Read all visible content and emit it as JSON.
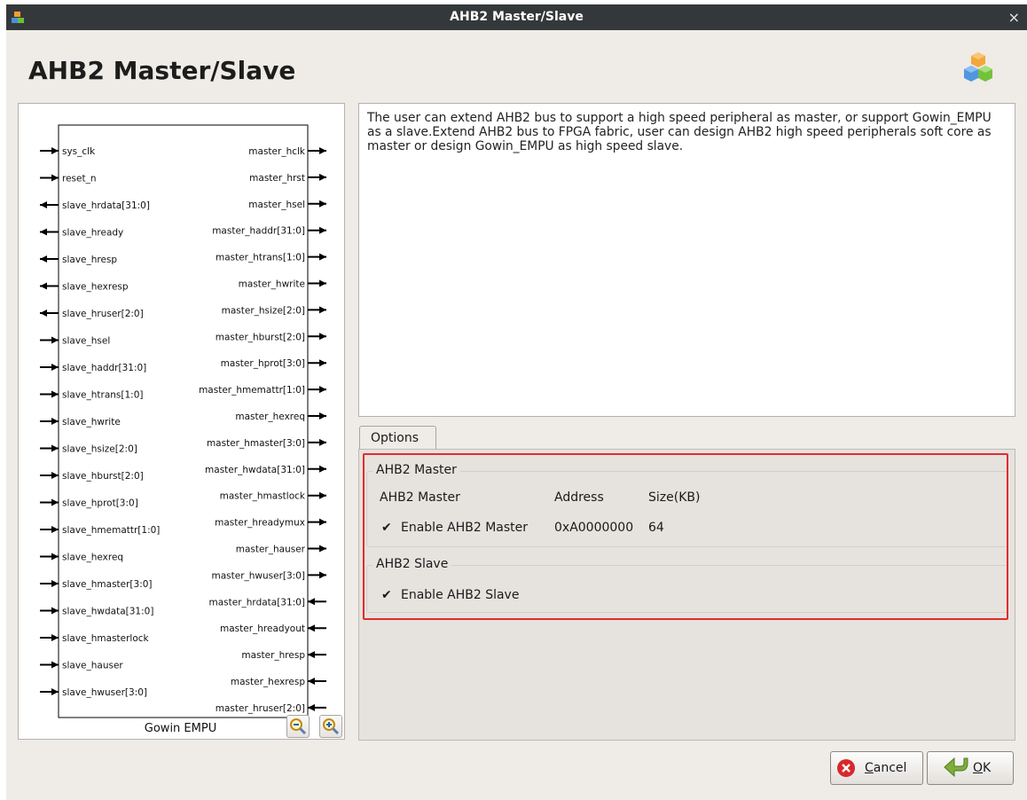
{
  "window": {
    "title": "AHB2 Master/Slave",
    "close_glyph": "×",
    "heading": "AHB2 Master/Slave",
    "app_icon": "cubes-icon",
    "logo_icon": "cubes-logo-icon"
  },
  "diagram": {
    "block_name": "Gowin EMPU",
    "left_ports": [
      {
        "name": "sys_clk",
        "dir": "in"
      },
      {
        "name": "reset_n",
        "dir": "in"
      },
      {
        "name": "slave_hrdata[31:0]",
        "dir": "out"
      },
      {
        "name": "slave_hready",
        "dir": "out"
      },
      {
        "name": "slave_hresp",
        "dir": "out"
      },
      {
        "name": "slave_hexresp",
        "dir": "out"
      },
      {
        "name": "slave_hruser[2:0]",
        "dir": "out"
      },
      {
        "name": "slave_hsel",
        "dir": "in"
      },
      {
        "name": "slave_haddr[31:0]",
        "dir": "in"
      },
      {
        "name": "slave_htrans[1:0]",
        "dir": "in"
      },
      {
        "name": "slave_hwrite",
        "dir": "in"
      },
      {
        "name": "slave_hsize[2:0]",
        "dir": "in"
      },
      {
        "name": "slave_hburst[2:0]",
        "dir": "in"
      },
      {
        "name": "slave_hprot[3:0]",
        "dir": "in"
      },
      {
        "name": "slave_hmemattr[1:0]",
        "dir": "in"
      },
      {
        "name": "slave_hexreq",
        "dir": "in"
      },
      {
        "name": "slave_hmaster[3:0]",
        "dir": "in"
      },
      {
        "name": "slave_hwdata[31:0]",
        "dir": "in"
      },
      {
        "name": "slave_hmasterlock",
        "dir": "in"
      },
      {
        "name": "slave_hauser",
        "dir": "in"
      },
      {
        "name": "slave_hwuser[3:0]",
        "dir": "in"
      }
    ],
    "right_ports": [
      {
        "name": "master_hclk",
        "dir": "out"
      },
      {
        "name": "master_hrst",
        "dir": "out"
      },
      {
        "name": "master_hsel",
        "dir": "out"
      },
      {
        "name": "master_haddr[31:0]",
        "dir": "out"
      },
      {
        "name": "master_htrans[1:0]",
        "dir": "out"
      },
      {
        "name": "master_hwrite",
        "dir": "out"
      },
      {
        "name": "master_hsize[2:0]",
        "dir": "out"
      },
      {
        "name": "master_hburst[2:0]",
        "dir": "out"
      },
      {
        "name": "master_hprot[3:0]",
        "dir": "out"
      },
      {
        "name": "master_hmemattr[1:0]",
        "dir": "out"
      },
      {
        "name": "master_hexreq",
        "dir": "out"
      },
      {
        "name": "master_hmaster[3:0]",
        "dir": "out"
      },
      {
        "name": "master_hwdata[31:0]",
        "dir": "out"
      },
      {
        "name": "master_hmastlock",
        "dir": "out"
      },
      {
        "name": "master_hreadymux",
        "dir": "out"
      },
      {
        "name": "master_hauser",
        "dir": "out"
      },
      {
        "name": "master_hwuser[3:0]",
        "dir": "out"
      },
      {
        "name": "master_hrdata[31:0]",
        "dir": "in"
      },
      {
        "name": "master_hreadyout",
        "dir": "in"
      },
      {
        "name": "master_hresp",
        "dir": "in"
      },
      {
        "name": "master_hexresp",
        "dir": "in"
      },
      {
        "name": "master_hruser[2:0]",
        "dir": "in"
      }
    ],
    "zoom_out_icon": "zoom-out-icon",
    "zoom_in_icon": "zoom-in-icon"
  },
  "description": "The user can extend AHB2 bus to support a high speed peripheral as master, or support Gowin_EMPU as a slave.Extend AHB2 bus to FPGA fabric, user can design AHB2 high speed peripherals soft core as master or design Gowin_EMPU as high speed slave.",
  "options": {
    "tab_label": "Options",
    "master_group": {
      "title": "AHB2 Master",
      "headers": {
        "name": "AHB2 Master",
        "address": "Address",
        "size": "Size(KB)"
      },
      "enable_label": "Enable AHB2 Master",
      "enabled": true,
      "address": "0xA0000000",
      "size": "64"
    },
    "slave_group": {
      "title": "AHB2 Slave",
      "enable_label": "Enable AHB2 Slave",
      "enabled": true
    },
    "check_glyph": "✔"
  },
  "buttons": {
    "cancel_label": "Cancel",
    "cancel_mnemonic": "C",
    "cancel_rest": "ancel",
    "ok_label": "OK",
    "ok_mnemonic": "O",
    "ok_rest": "K",
    "cancel_icon": "cancel-x-icon",
    "ok_icon": "ok-arrow-icon"
  }
}
